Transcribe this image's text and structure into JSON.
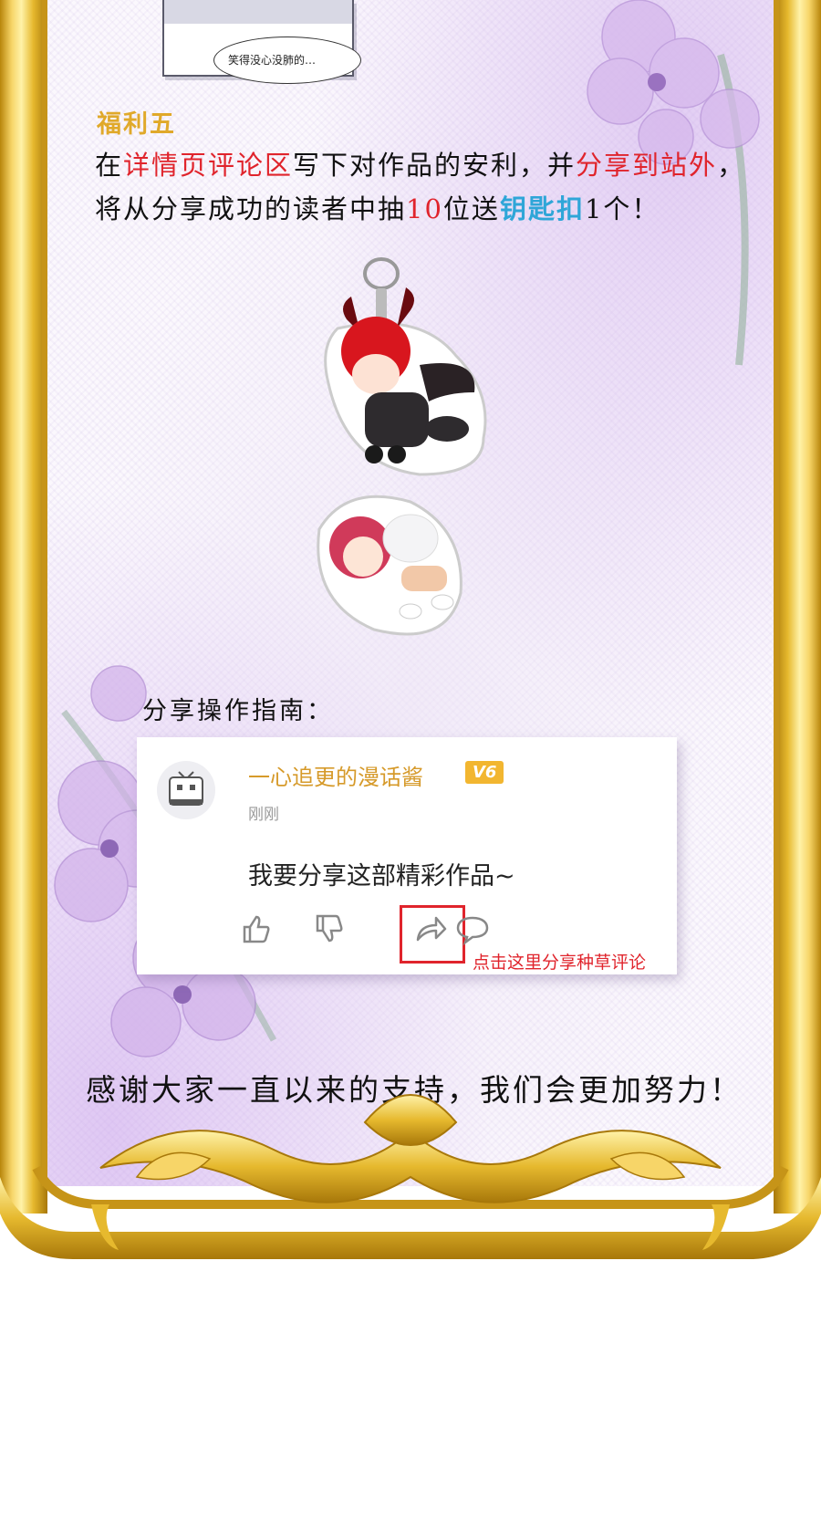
{
  "top_panel": {
    "caption": "笑得没心没肺的…"
  },
  "benefit": {
    "heading": "福利五",
    "line1": {
      "a": "在",
      "b": "详情页评论区",
      "c": "写下对作品的安利，并",
      "d": "分享到站外",
      "e": "，"
    },
    "line2": {
      "a": "将从分享成功的读者中抽",
      "b": "10",
      "c": "位送",
      "d": "钥匙扣",
      "e": "1个！"
    }
  },
  "guide_title": "分享操作指南：",
  "comment_card": {
    "username": "一心追更的漫话酱",
    "level": "V6",
    "time": "刚刚",
    "text": "我要分享这部精彩作品~",
    "hint": "点击这里分享种草评论"
  },
  "footer": "感谢大家一直以来的支持，我们会更加努力！",
  "colors": {
    "gold": "#e0a92a",
    "red": "#e0242c",
    "blue": "#2fa6d8"
  }
}
